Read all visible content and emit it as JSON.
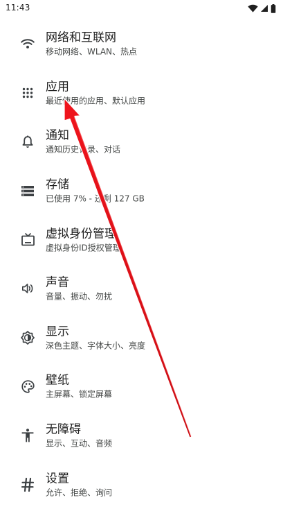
{
  "status_bar": {
    "time": "11:43",
    "icons": [
      "wifi-icon",
      "signal-icon",
      "battery-icon"
    ]
  },
  "settings": {
    "items": [
      {
        "title": "网络和互联网",
        "subtitle": "移动网络、WLAN、热点",
        "icon": "wifi-icon"
      },
      {
        "title": "应用",
        "subtitle": "最近使用的应用、默认应用",
        "icon": "apps-grid-icon"
      },
      {
        "title": "通知",
        "subtitle": "通知历史记录、对话",
        "icon": "bell-icon"
      },
      {
        "title": "存储",
        "subtitle": "已使用 7% - 还剩 127 GB",
        "icon": "storage-icon"
      },
      {
        "title": "虚拟身份管理",
        "subtitle": "虚拟身份ID授权管理",
        "icon": "tv-icon"
      },
      {
        "title": "声音",
        "subtitle": "音量、振动、勿扰",
        "icon": "volume-icon"
      },
      {
        "title": "显示",
        "subtitle": "深色主题、字体大小、亮度",
        "icon": "brightness-icon"
      },
      {
        "title": "壁纸",
        "subtitle": "主屏幕、锁定屏幕",
        "icon": "palette-icon"
      },
      {
        "title": "无障碍",
        "subtitle": "显示、互动、音频",
        "icon": "accessibility-icon"
      },
      {
        "title": "设置",
        "subtitle": "允许、拒绝、询问",
        "icon": "hash-icon"
      }
    ]
  },
  "colors": {
    "icon": "#3c4043",
    "annotation_arrow": "#e8141b"
  }
}
